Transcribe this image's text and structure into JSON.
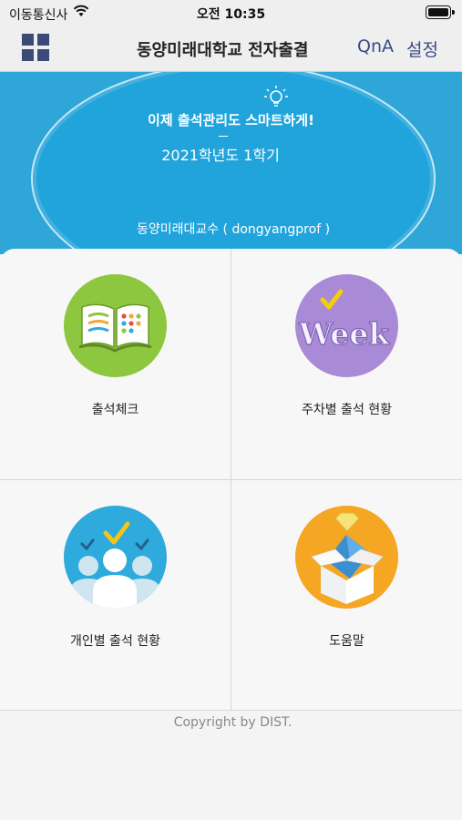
{
  "status_bar": {
    "carrier": "이동통신사",
    "time": "오전 10:35"
  },
  "navbar": {
    "title": "동양미래대학교 전자출결",
    "qna": "QnA",
    "settings": "설정"
  },
  "hero": {
    "slogan": "이제 출석관리도 스마트하게!",
    "semester": "2021학년도 1학기",
    "professor": "동양미래대교수 ( dongyangprof )"
  },
  "menu": [
    {
      "label": "출석체크",
      "icon": "book-icon"
    },
    {
      "label": "주차별 출석 현황",
      "icon": "week-icon",
      "icon_text": "Week"
    },
    {
      "label": "개인별 출석 현황",
      "icon": "people-icon"
    },
    {
      "label": "도움말",
      "icon": "help-box-icon"
    }
  ],
  "footer": {
    "copyright": "Copyright by  DIST."
  },
  "colors": {
    "hero": "#2ea6d8",
    "nav_accent": "#3b4a86",
    "book": "#8dc63f",
    "week": "#a98ad6",
    "people": "#2eaadc",
    "help": "#f5a623"
  }
}
